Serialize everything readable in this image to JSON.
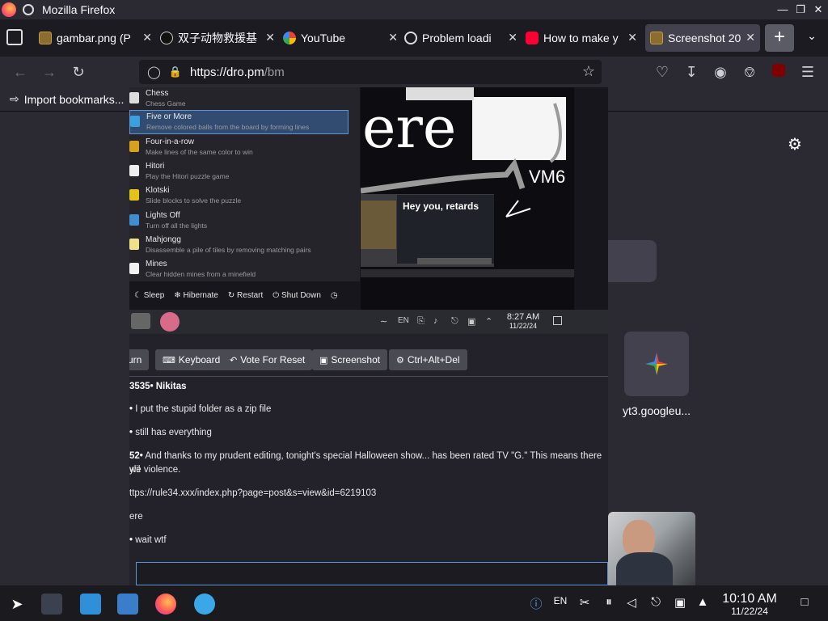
{
  "window": {
    "title": "Mozilla Firefox"
  },
  "tabs": [
    {
      "label": "gambar.png (P",
      "favicon": "image-file-icon"
    },
    {
      "label": "双子动物救援基",
      "favicon": "panda-icon"
    },
    {
      "label": "YouTube",
      "favicon": "google-icon"
    },
    {
      "label": "Problem loadi",
      "favicon": "info-icon"
    },
    {
      "label": "How to make y",
      "favicon": "youtube-icon"
    },
    {
      "label": "Screenshot 20",
      "favicon": "image-file-icon",
      "active": true
    }
  ],
  "navbar": {
    "url_host": "https://dro.pm",
    "url_path": "/bm"
  },
  "bookmarks": {
    "import_label": "Import bookmarks..."
  },
  "newtab": {
    "shortcut_label": "yt3.googleu..."
  },
  "vm": {
    "menu": [
      {
        "title": "Chess",
        "desc": "Chess Game"
      },
      {
        "title": "Five or More",
        "desc": "Remove colored balls from the board by forming lines"
      },
      {
        "title": "Four-in-a-row",
        "desc": "Make lines of the same color to win"
      },
      {
        "title": "Hitori",
        "desc": "Play the Hitori puzzle game"
      },
      {
        "title": "Klotski",
        "desc": "Slide blocks to solve the puzzle"
      },
      {
        "title": "Lights Off",
        "desc": "Turn off all the lights"
      },
      {
        "title": "Mahjongg",
        "desc": "Disassemble a pile of tiles by removing matching pairs"
      },
      {
        "title": "Mines",
        "desc": "Clear hidden mines from a minefield"
      }
    ],
    "power": {
      "sleep": "Sleep",
      "hibernate": "Hibernate",
      "restart": "Restart",
      "shutdown": "Shut Down"
    },
    "drawing": {
      "scribble": "ere",
      "vm_label": "VM6",
      "banner": "Hey you, retards"
    },
    "taskbar": {
      "lang": "EN",
      "time": "8:27 AM",
      "date": "11/22/24"
    }
  },
  "controls": {
    "turn": "urn",
    "keyboard": "Keyboard",
    "vote_reset": "Vote For Reset",
    "screenshot": "Screenshot",
    "cad": "Ctrl+Alt+Del"
  },
  "chat": [
    {
      "user": "3535• Nikitas",
      "text": ""
    },
    {
      "user": "•",
      "text": "I put the stupid folder as a zip file"
    },
    {
      "user": "•",
      "text": "still has everything"
    },
    {
      "user": "52•",
      "text": "And thanks to my prudent editing, tonight's special Halloween show... has been rated TV \"G.\" This means there wil"
    },
    {
      "user": "",
      "text": "yle violence."
    },
    {
      "user": "",
      "text": "ttps://rule34.xxx/index.php?page=post&s=view&id=6219103"
    },
    {
      "user": "",
      "text": "ere"
    },
    {
      "user": "•",
      "text": "wait wtf"
    }
  ],
  "panel": {
    "lang": "EN",
    "time": "10:10 AM",
    "date": "11/22/24"
  }
}
